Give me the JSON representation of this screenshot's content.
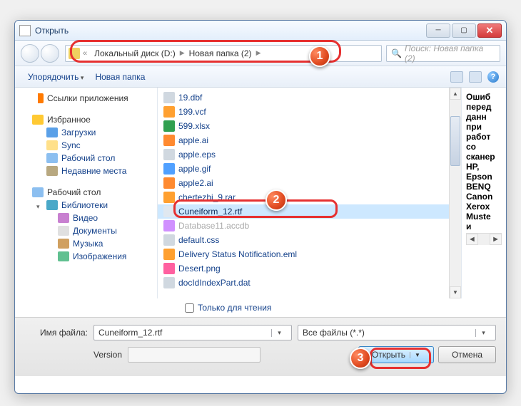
{
  "window": {
    "title": "Открыть"
  },
  "breadcrumb": {
    "drive": "Локальный диск (D:)",
    "folder": "Новая папка (2)"
  },
  "search": {
    "placeholder": "Поиск: Новая папка (2)"
  },
  "toolbar": {
    "organize": "Упорядочить",
    "newfolder": "Новая папка"
  },
  "sidebar": {
    "appLinks": "Ссылки приложения",
    "favorites": "Избранное",
    "downloads": "Загрузки",
    "sync": "Sync",
    "desktop1": "Рабочий стол",
    "recent": "Недавние места",
    "desktop2": "Рабочий стол",
    "libraries": "Библиотеки",
    "videos": "Видео",
    "documents": "Документы",
    "music": "Музыка",
    "pictures": "Изображения"
  },
  "files": [
    {
      "name": "19.dbf",
      "icon": "dbf"
    },
    {
      "name": "199.vcf",
      "icon": "vcf"
    },
    {
      "name": "599.xlsx",
      "icon": "xlsx"
    },
    {
      "name": "apple.ai",
      "icon": "ai"
    },
    {
      "name": "apple.eps",
      "icon": "eps"
    },
    {
      "name": "apple.gif",
      "icon": "gif"
    },
    {
      "name": "apple2.ai",
      "icon": "ai"
    },
    {
      "name": "chertezhi_9.rar",
      "icon": "rar"
    },
    {
      "name": "Cuneiform_12.rtf",
      "icon": "rtf",
      "selected": true
    },
    {
      "name": "Database11.accdb",
      "icon": "accdb",
      "dimmed": true
    },
    {
      "name": "default.css",
      "icon": "css"
    },
    {
      "name": "Delivery Status Notification.eml",
      "icon": "eml"
    },
    {
      "name": "Desert.png",
      "icon": "png"
    },
    {
      "name": "docIdIndexPart.dat",
      "icon": "dat"
    }
  ],
  "preview": [
    "Ошиб",
    "перед",
    "данн",
    "при",
    "работ",
    "со",
    "сканер",
    "HP,",
    "Epson",
    "BENQ",
    "Canon",
    "Xerox",
    "Muste",
    "и"
  ],
  "readonly": "Только для чтения",
  "filenameLabel": "Имя файла:",
  "filenameValue": "Cuneiform_12.rtf",
  "filter": "Все файлы (*.*)",
  "versionLabel": "Version",
  "openBtn": "Открыть",
  "cancelBtn": "Отмена",
  "markers": {
    "m1": "1",
    "m2": "2",
    "m3": "3"
  }
}
